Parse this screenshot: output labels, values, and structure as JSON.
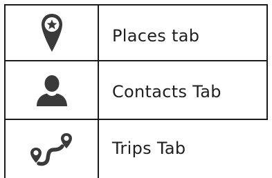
{
  "rows": [
    {
      "icon": "map-pin-star-icon",
      "label": "Places tab"
    },
    {
      "icon": "person-icon",
      "label": "Contacts Tab"
    },
    {
      "icon": "route-icon",
      "label": "Trips Tab"
    }
  ],
  "colors": {
    "icon": "#3a3a3a",
    "border": "#1a1a1a",
    "text": "#1f1f1f"
  }
}
